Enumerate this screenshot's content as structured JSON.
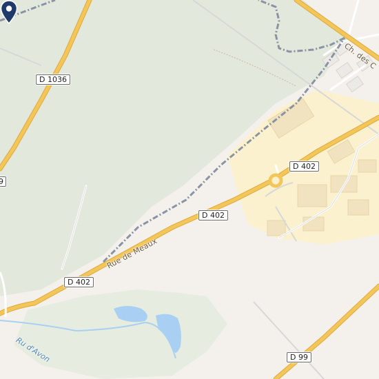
{
  "map": {
    "colors": {
      "background": "#f4f1ec",
      "forest": "#e3e8dc",
      "industrial": "#fbf1cf",
      "road_fill": "#f3c65a",
      "road_casing": "#e0a83a",
      "water": "#a9d0f2",
      "boundary": "#8a93a3",
      "marker": "#1f3a6b"
    },
    "route_labels": {
      "d1036": "D 1036",
      "d402_top": "D 402",
      "d402_mid": "D 402",
      "d402_left": "D 402",
      "d99": "D 99",
      "edge_left": "9"
    },
    "street_labels": {
      "rue_de_meaux": "Rue de Meaux",
      "ch_des": "Ch. des C"
    },
    "water_labels": {
      "ru_d_avon": "Ru d'Avon"
    },
    "marker": {
      "icon": "location-pin-icon"
    }
  }
}
